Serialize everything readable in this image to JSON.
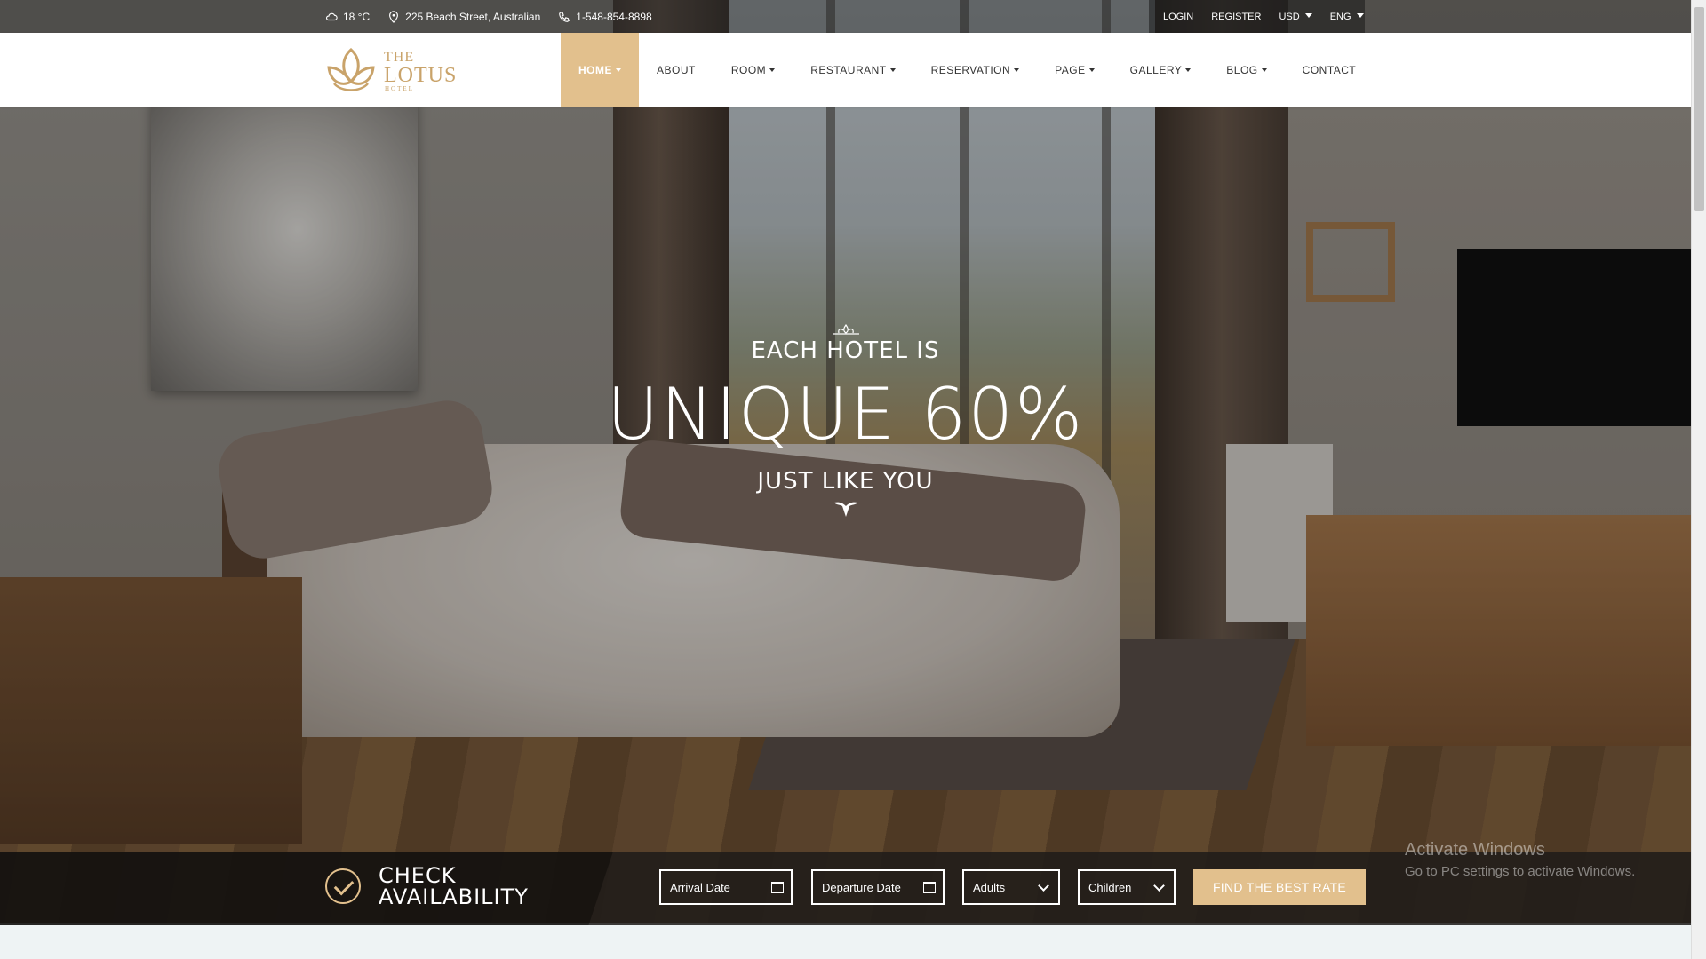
{
  "topbar": {
    "weather": "18 °C",
    "address": "225 Beach Street, Australian",
    "phone": "1-548-854-8898",
    "login": "LOGIN",
    "register": "REGISTER",
    "currency": "USD",
    "language": "ENG"
  },
  "logo": {
    "line1": "THE",
    "line2": "LOTUS",
    "line3": "HOTEL"
  },
  "nav": {
    "items": [
      {
        "label": "HOME",
        "dropdown": true,
        "active": true
      },
      {
        "label": "ABOUT",
        "dropdown": false
      },
      {
        "label": "ROOM",
        "dropdown": true
      },
      {
        "label": "RESTAURANT",
        "dropdown": true
      },
      {
        "label": "RESERVATION",
        "dropdown": true
      },
      {
        "label": "PAGE",
        "dropdown": true
      },
      {
        "label": "GALLERY",
        "dropdown": true
      },
      {
        "label": "BLOG",
        "dropdown": true
      },
      {
        "label": "CONTACT",
        "dropdown": false
      }
    ]
  },
  "hero": {
    "line1": "EACH HOTEL IS",
    "line2": "UNIQUE 60%",
    "line3": "JUST LIKE YOU"
  },
  "availability": {
    "title_line1": "CHECK",
    "title_line2": "AVAILABILITY",
    "arrival_placeholder": "Arrival Date",
    "departure_placeholder": "Departure Date",
    "adults": "Adults",
    "children": "Children",
    "submit": "FIND THE BEST RATE"
  },
  "watermark": {
    "line1": "Activate Windows",
    "line2": "Go to PC settings to activate Windows."
  },
  "colors": {
    "accent": "#e2c08d",
    "logo": "#c9a36a"
  }
}
